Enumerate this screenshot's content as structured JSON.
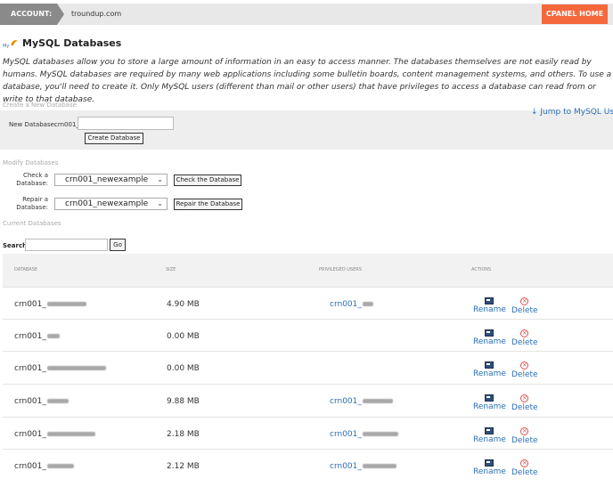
{
  "topbar": {
    "account_label": "ACCOUNT:",
    "domain": "troundup.com",
    "cpanel_home": "CPANEL HOME"
  },
  "header": {
    "title": "MySQL Databases"
  },
  "intro": "MySQL databases allow you to store a large amount of information in an easy to access manner. The databases themselves are not easily read by humans. MySQL databases are required by many web applications including some bulletin boards, content management systems, and others. To use a database, you'll need to create it. Only MySQL users (different than mail or other users) that have privileges to access a database can read from or write to that database.",
  "create": {
    "section_label": "Create a New Database",
    "new_db_label": "New Database:",
    "prefix": "crn001_",
    "input_value": "",
    "button": "Create Database",
    "jump_link": "↓ Jump to MySQL Users"
  },
  "modify": {
    "section_label": "Modify Databases",
    "check_label_1": "Check a",
    "check_label_2": "Database:",
    "check_selected": "crn001_newexample",
    "check_button": "Check the Database",
    "repair_label_1": "Repair a",
    "repair_label_2": "Database:",
    "repair_selected": "crn001_newexample",
    "repair_button": "Repair the Database"
  },
  "current": {
    "section_label": "Current Databases",
    "search_label": "Search",
    "search_value": "",
    "go_button": "Go",
    "columns": {
      "database": "DATABASE",
      "size": "SIZE",
      "users": "PRIVILEGED USERS",
      "actions": "ACTIONS"
    },
    "rename_label": "Rename",
    "delete_label": "Delete",
    "rows": [
      {
        "db_prefix": "crn001_",
        "size": "4.90 MB",
        "user_prefix": "crn001_"
      },
      {
        "db_prefix": "crn001_",
        "size": "0.00 MB",
        "user_prefix": ""
      },
      {
        "db_prefix": "crn001_",
        "size": "0.00 MB",
        "user_prefix": ""
      },
      {
        "db_prefix": "crn001_",
        "size": "9.88 MB",
        "user_prefix": "crn001_"
      },
      {
        "db_prefix": "crn001_",
        "size": "2.18 MB",
        "user_prefix": "crn001_"
      },
      {
        "db_prefix": "crn001_",
        "size": "2.12 MB",
        "user_prefix": "crn001_"
      }
    ]
  },
  "colors": {
    "accent": "#f4683c",
    "link": "#2a6fb5",
    "delete": "#d9534f"
  },
  "icons": {
    "rename": "rename-icon",
    "delete": "delete-icon",
    "logo": "mysql-logo-icon",
    "chevron": "chevron-down-icon"
  }
}
